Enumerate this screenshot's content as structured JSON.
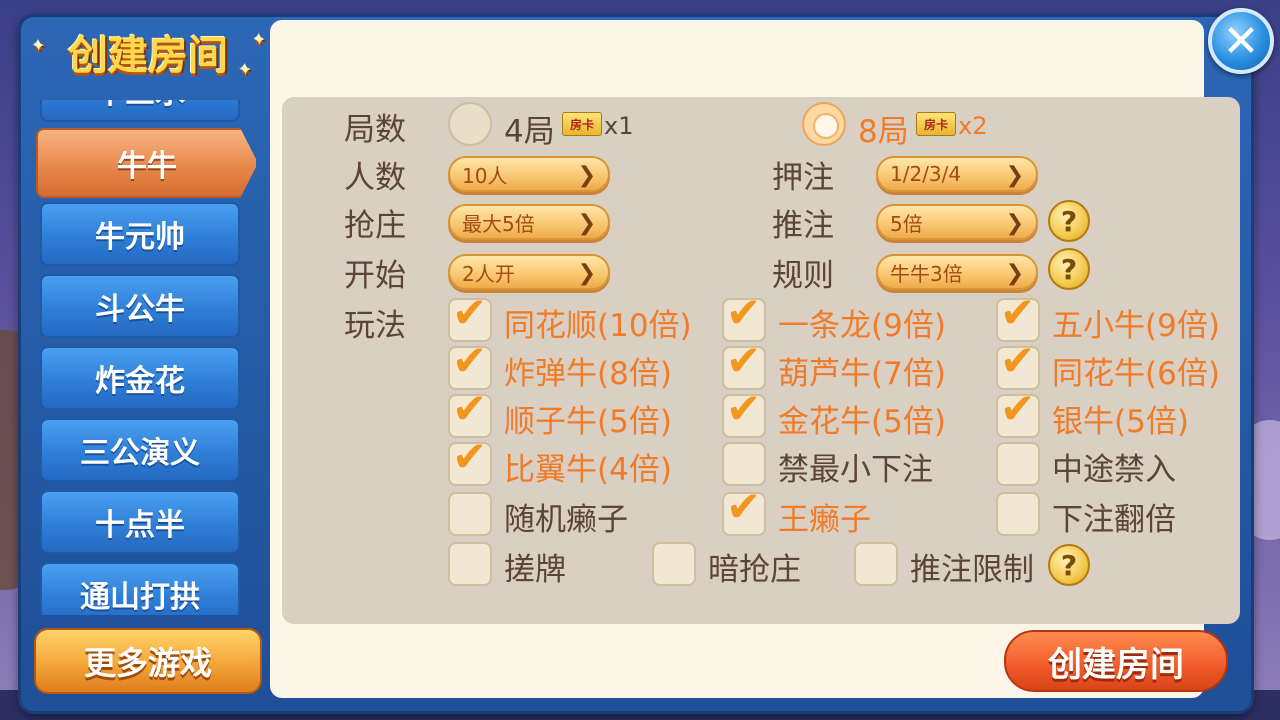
{
  "title": "创建房间",
  "tabs": [
    {
      "label": "十三水"
    },
    {
      "label": "牛牛",
      "active": true
    },
    {
      "label": "牛元帅"
    },
    {
      "label": "斗公牛"
    },
    {
      "label": "炸金花"
    },
    {
      "label": "三公演义"
    },
    {
      "label": "十点半"
    },
    {
      "label": "通山打拱"
    }
  ],
  "more_games_label": "更多游戏",
  "create_button_label": "创建房间",
  "close_icon": "close-icon",
  "settings": {
    "rounds": {
      "label": "局数",
      "options": [
        {
          "text": "4局",
          "badge": "房卡",
          "multiplier": "x1",
          "selected": false
        },
        {
          "text": "8局",
          "badge": "房卡",
          "multiplier": "x2",
          "selected": true
        }
      ]
    },
    "players": {
      "label": "人数",
      "value": "10人"
    },
    "bet": {
      "label": "押注",
      "value": "1/2/3/4"
    },
    "banker": {
      "label": "抢庄",
      "value": "最大5倍"
    },
    "push_bet": {
      "label": "推注",
      "value": "5倍"
    },
    "start": {
      "label": "开始",
      "value": "2人开"
    },
    "rules": {
      "label": "规则",
      "value": "牛牛3倍"
    },
    "play_label": "玩法",
    "play_options": [
      {
        "text": "同花顺(10倍)",
        "checked": true
      },
      {
        "text": "一条龙(9倍)",
        "checked": true
      },
      {
        "text": "五小牛(9倍)",
        "checked": true
      },
      {
        "text": "炸弹牛(8倍)",
        "checked": true
      },
      {
        "text": "葫芦牛(7倍)",
        "checked": true
      },
      {
        "text": "同花牛(6倍)",
        "checked": true
      },
      {
        "text": "顺子牛(5倍)",
        "checked": true
      },
      {
        "text": "金花牛(5倍)",
        "checked": true
      },
      {
        "text": "银牛(5倍)",
        "checked": true
      },
      {
        "text": "比翼牛(4倍)",
        "checked": true
      },
      {
        "text": "禁最小下注",
        "checked": false
      },
      {
        "text": "中途禁入",
        "checked": false
      },
      {
        "text": "随机癞子",
        "checked": false
      },
      {
        "text": "王癞子",
        "checked": true
      },
      {
        "text": "下注翻倍",
        "checked": false
      },
      {
        "text": "搓牌",
        "checked": false
      },
      {
        "text": "暗抢庄",
        "checked": false
      },
      {
        "text": "推注限制",
        "checked": false
      }
    ],
    "help_symbol": "?",
    "chevron_symbol": "❯",
    "tick_symbol": "✔"
  },
  "colors": {
    "accent_orange": "#f07c2a",
    "label_brown": "#5b4536",
    "tab_blue": "#2f7fd7",
    "tab_active": "#e68548",
    "create_button": "#f05b2a"
  }
}
